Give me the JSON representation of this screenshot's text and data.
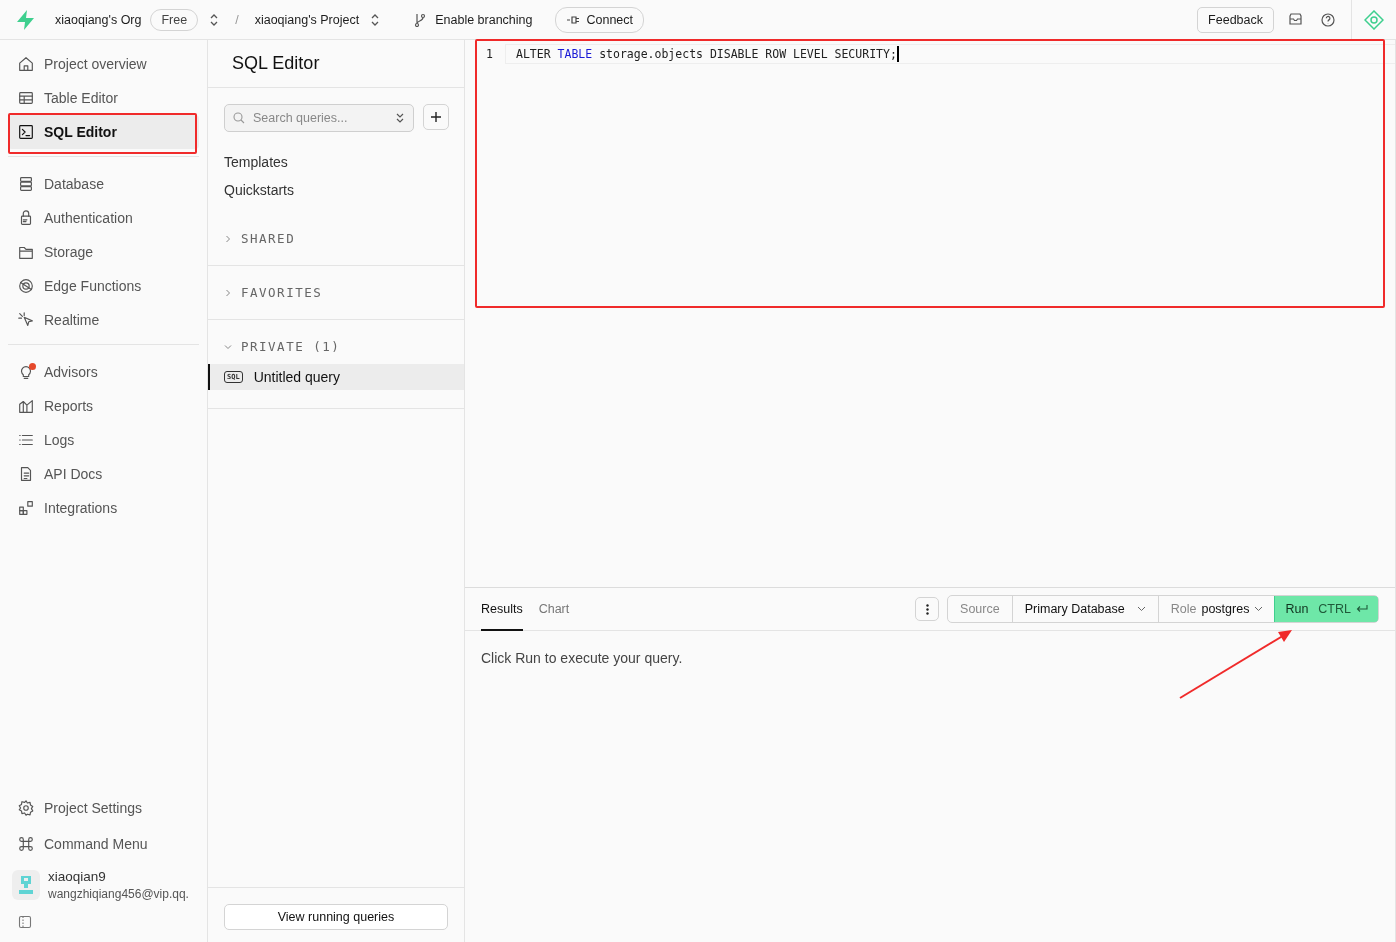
{
  "topbar": {
    "org": "xiaoqiang's Org",
    "plan": "Free",
    "separator": "/",
    "project": "xiaoqiang's Project",
    "branching": "Enable branching",
    "connect": "Connect",
    "feedback": "Feedback"
  },
  "sidebar": {
    "groups": [
      [
        {
          "label": "Project overview",
          "selected": false
        },
        {
          "label": "Table Editor",
          "selected": false
        },
        {
          "label": "SQL Editor",
          "selected": true
        }
      ],
      [
        {
          "label": "Database",
          "selected": false
        },
        {
          "label": "Authentication",
          "selected": false
        },
        {
          "label": "Storage",
          "selected": false
        },
        {
          "label": "Edge Functions",
          "selected": false
        },
        {
          "label": "Realtime",
          "selected": false
        }
      ],
      [
        {
          "label": "Advisors",
          "selected": false
        },
        {
          "label": "Reports",
          "selected": false
        },
        {
          "label": "Logs",
          "selected": false
        },
        {
          "label": "API Docs",
          "selected": false
        },
        {
          "label": "Integrations",
          "selected": false
        }
      ]
    ],
    "bottom": [
      {
        "label": "Project Settings",
        "selected": false
      },
      {
        "label": "Command Menu",
        "selected": false
      }
    ],
    "user": {
      "name": "xiaoqian9",
      "email": "wangzhiqiang456@vip.qq."
    }
  },
  "query_panel": {
    "title": "SQL Editor",
    "search": {
      "placeholder": "Search queries..."
    },
    "links": [
      "Templates",
      "Quickstarts"
    ],
    "sections": [
      {
        "label": "SHARED",
        "expanded": false
      },
      {
        "label": "FAVORITES",
        "expanded": false
      },
      {
        "label": "PRIVATE (1)",
        "expanded": true,
        "items": [
          {
            "label": "Untitled query",
            "badge": "SQL",
            "selected": true
          }
        ]
      }
    ],
    "footer_button": "View running queries"
  },
  "editor": {
    "lines": [
      {
        "number": "1",
        "tokens": [
          {
            "text": "ALTER",
            "kind": "plain"
          },
          {
            "text": "TABLE",
            "kind": "keyword"
          },
          {
            "text": "storage.objects DISABLE ROW LEVEL SECURITY;",
            "kind": "plain"
          }
        ]
      }
    ]
  },
  "results": {
    "tabs": [
      {
        "label": "Results",
        "selected": true
      },
      {
        "label": "Chart",
        "selected": false
      }
    ],
    "source_label": "Source",
    "database": "Primary Database",
    "role_label": "Role",
    "role": "postgres",
    "run": {
      "label": "Run",
      "shortcut": "CTRL"
    },
    "message": "Click Run to execute your query."
  }
}
